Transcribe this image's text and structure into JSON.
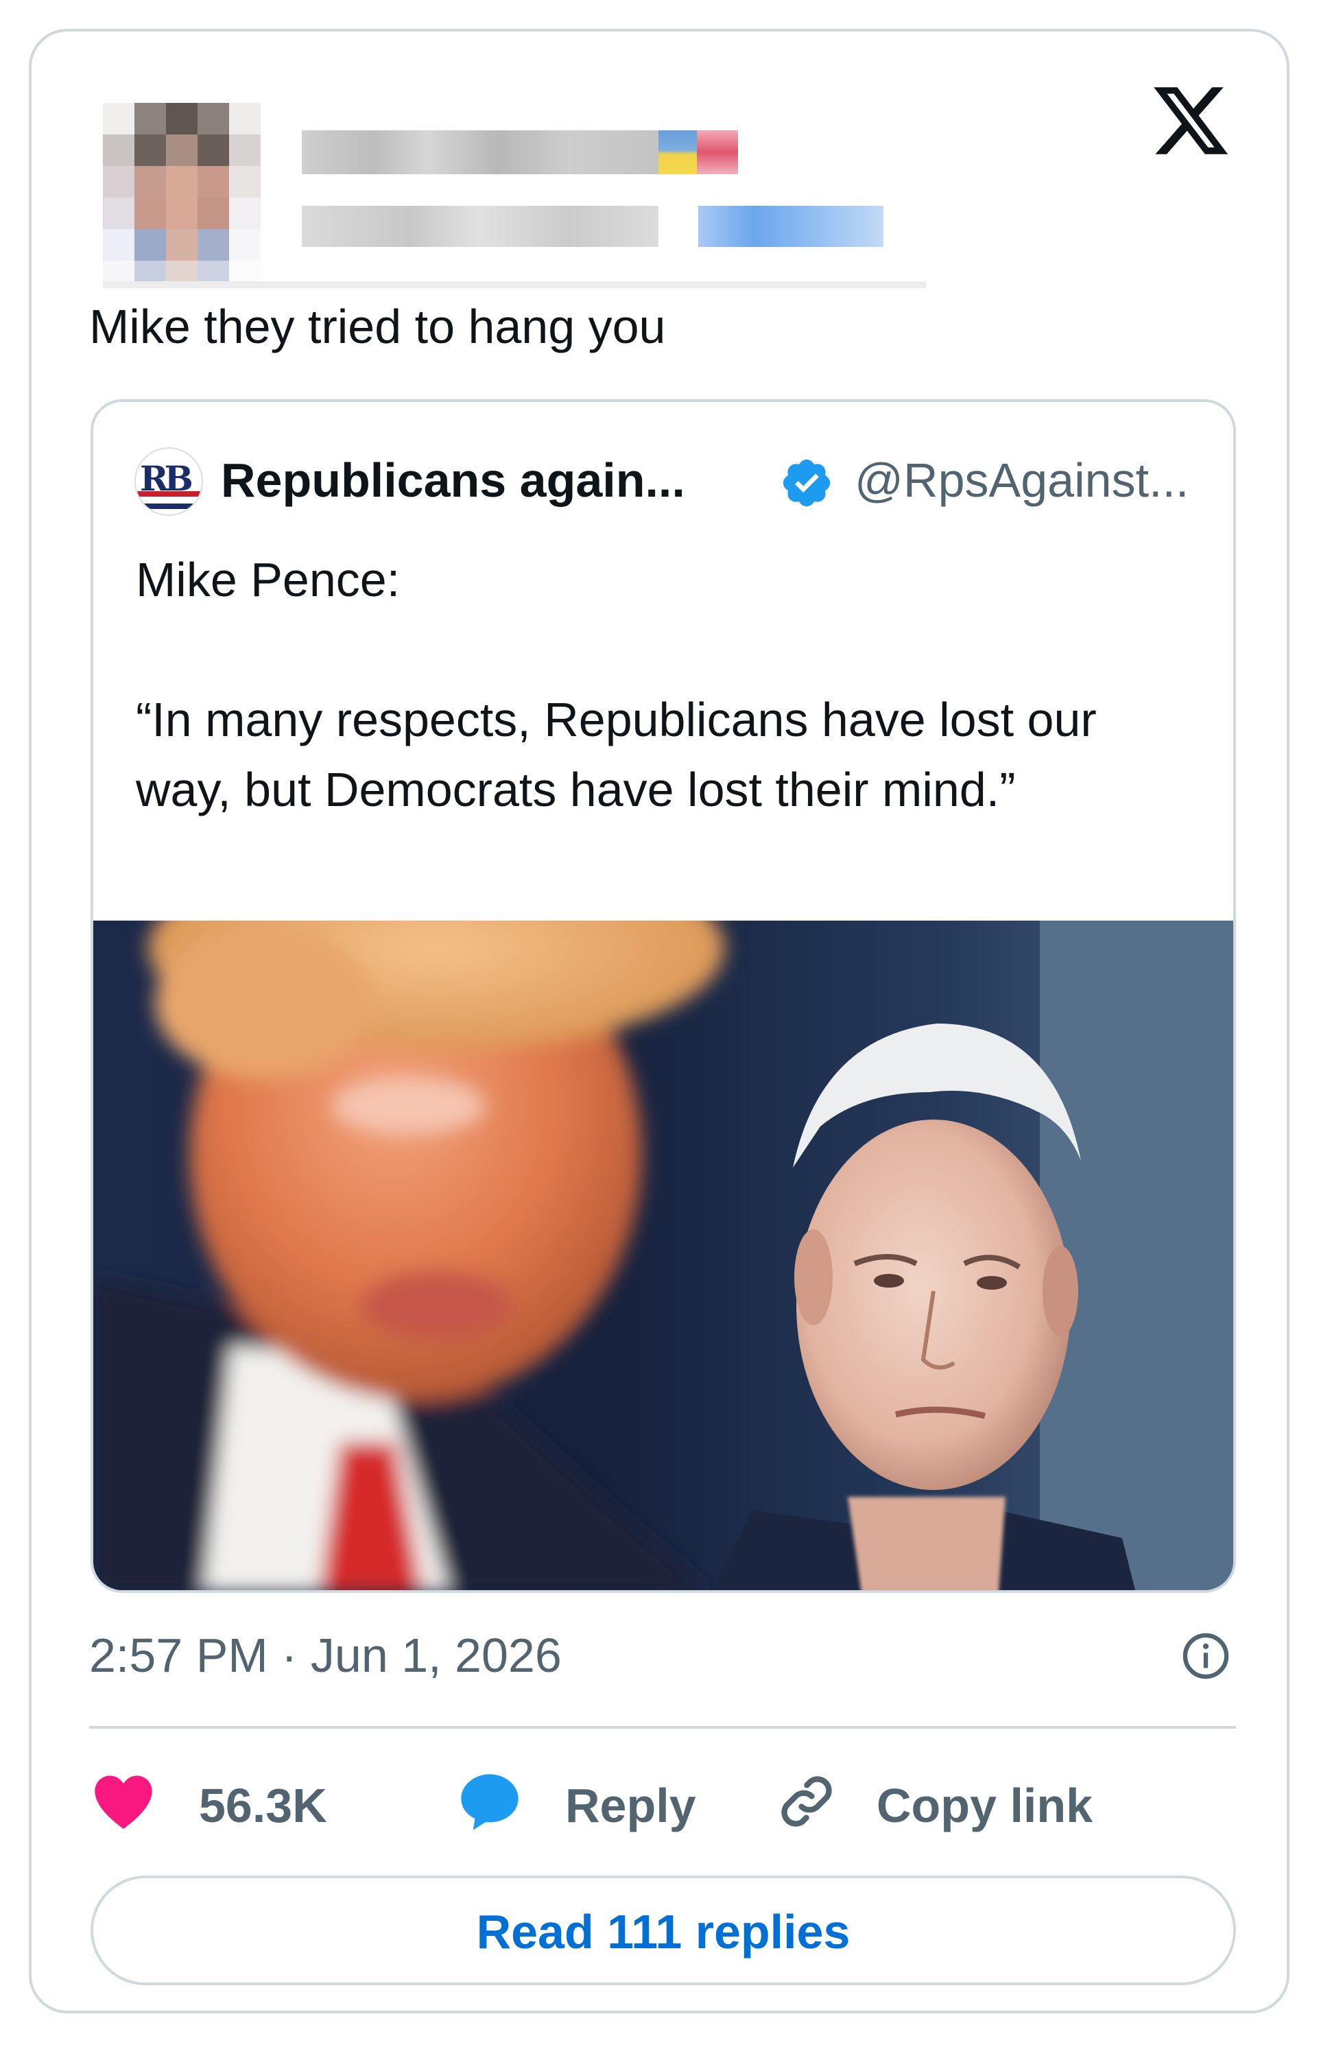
{
  "tweet": {
    "text": "Mike they tried to hang you",
    "timestamp": "2:57 PM · Jun 1, 2026"
  },
  "quoted_tweet": {
    "name": "Republicans again...",
    "handle": "@RpsAgainst...",
    "avatar_text": "RB",
    "body_line_1": "Mike Pence:",
    "body_line_2": "“In many respects, Republicans have lost our way, but Democrats have lost their mind.”"
  },
  "actions": {
    "like_count": "56.3K",
    "reply_label": "Reply",
    "copy_link_label": "Copy link",
    "read_replies_label": "Read 111 replies"
  },
  "icons": {
    "brand": "x-logo-icon",
    "verified": "verified-badge-icon",
    "info": "info-icon",
    "like": "heart-icon",
    "reply": "speech-bubble-icon",
    "copy_link": "link-icon"
  },
  "colors": {
    "like": "#f91880",
    "reply": "#1d9bf0",
    "verified": "#1d9bf0",
    "link_text": "#006fd6",
    "muted_text": "#536471",
    "border": "#cfd9de"
  }
}
